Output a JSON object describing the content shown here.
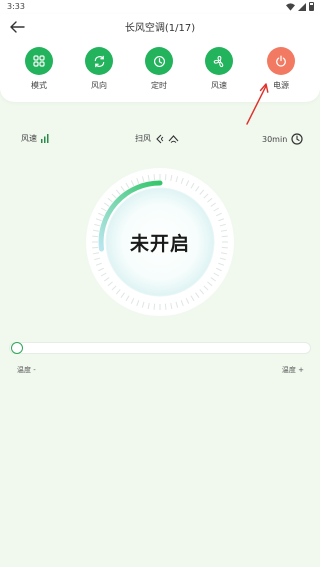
{
  "status_bar": {
    "time": "3:33",
    "icons": [
      "wifi-icon",
      "signal-icon",
      "battery-icon"
    ]
  },
  "header": {
    "title": "长风空调(1/17)",
    "back_icon": "back-arrow-icon"
  },
  "controls": [
    {
      "label": "模式",
      "icon": "mode-grid-icon"
    },
    {
      "label": "风向",
      "icon": "swing-rotate-icon"
    },
    {
      "label": "定时",
      "icon": "timer-clock-icon"
    },
    {
      "label": "风速",
      "icon": "fan-icon"
    },
    {
      "label": "电源",
      "icon": "power-icon"
    }
  ],
  "colors": {
    "accent": "#22b35c",
    "power": "#f27a62",
    "background": "#f1f9ef",
    "annotation_arrow": "#e0302a"
  },
  "info": {
    "fan_speed_label": "风速",
    "swing_label": "扫风",
    "timer_value": "30min"
  },
  "dial": {
    "status": "未开启"
  },
  "temperature": {
    "minus_label": "温度 -",
    "plus_label": "温度 +",
    "level": 0
  }
}
